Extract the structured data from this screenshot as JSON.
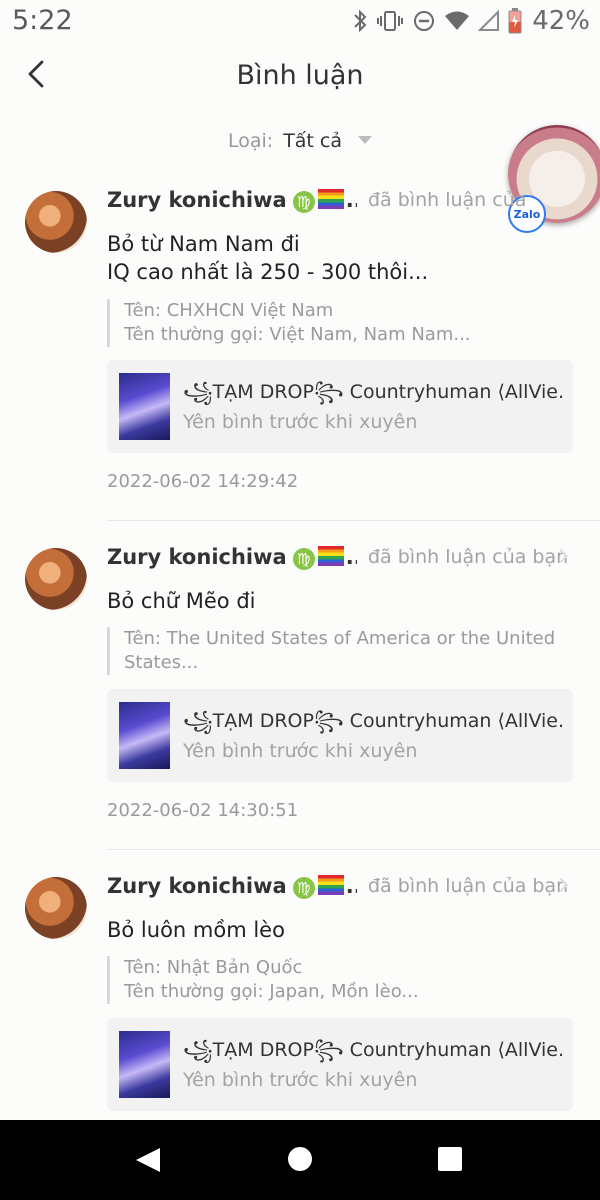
{
  "status": {
    "time": "5:22",
    "battery": "42%",
    "icons": [
      "bluetooth-icon",
      "vibrate-icon",
      "dnd-icon",
      "wifi-icon",
      "signal-icon",
      "battery-icon"
    ]
  },
  "header": {
    "title": "Bình luận"
  },
  "filter": {
    "label": "Loại:",
    "value": "Tất cả"
  },
  "bubble": {
    "badge": "Zalo"
  },
  "comments": [
    {
      "author": "Zury konichiwa",
      "zodiac": "♍",
      "ellipsis": "...",
      "action": "đã bình luận của",
      "text_lines": [
        "Bỏ từ Nam Nam đi",
        "IQ cao nhất là 250 - 300 thôi..."
      ],
      "quote_lines": [
        "Tên: CHXHCN Việt Nam",
        "Tên thường gọi: Việt Nam, Nam Nam..."
      ],
      "card_title": "꧁TẠM DROP꧂ Countryhuman ⟨AllVie...",
      "card_sub": "Yên bình trước khi xuyên",
      "time": "2022-06-02 14:29:42"
    },
    {
      "author": "Zury konichiwa",
      "zodiac": "♍",
      "ellipsis": "...",
      "action": "đã bình luận của bạn",
      "text_lines": [
        "Bỏ chữ Mẽo đi"
      ],
      "quote_lines": [
        "Tên: The United States of America or the United",
        "States..."
      ],
      "card_title": "꧁TẠM DROP꧂ Countryhuman ⟨AllVie...",
      "card_sub": "Yên bình trước khi xuyên",
      "time": "2022-06-02 14:30:51"
    },
    {
      "author": "Zury konichiwa",
      "zodiac": "♍",
      "ellipsis": "...",
      "action": "đã bình luận của bạn",
      "text_lines": [
        "Bỏ luôn mồm lèo"
      ],
      "quote_lines": [
        "Tên: Nhật Bản Quốc",
        "Tên thường gọi: Japan, Mồn lèo..."
      ],
      "card_title": "꧁TẠM DROP꧂ Countryhuman ⟨AllVie...",
      "card_sub": "Yên bình trước khi xuyên",
      "time": ""
    }
  ]
}
